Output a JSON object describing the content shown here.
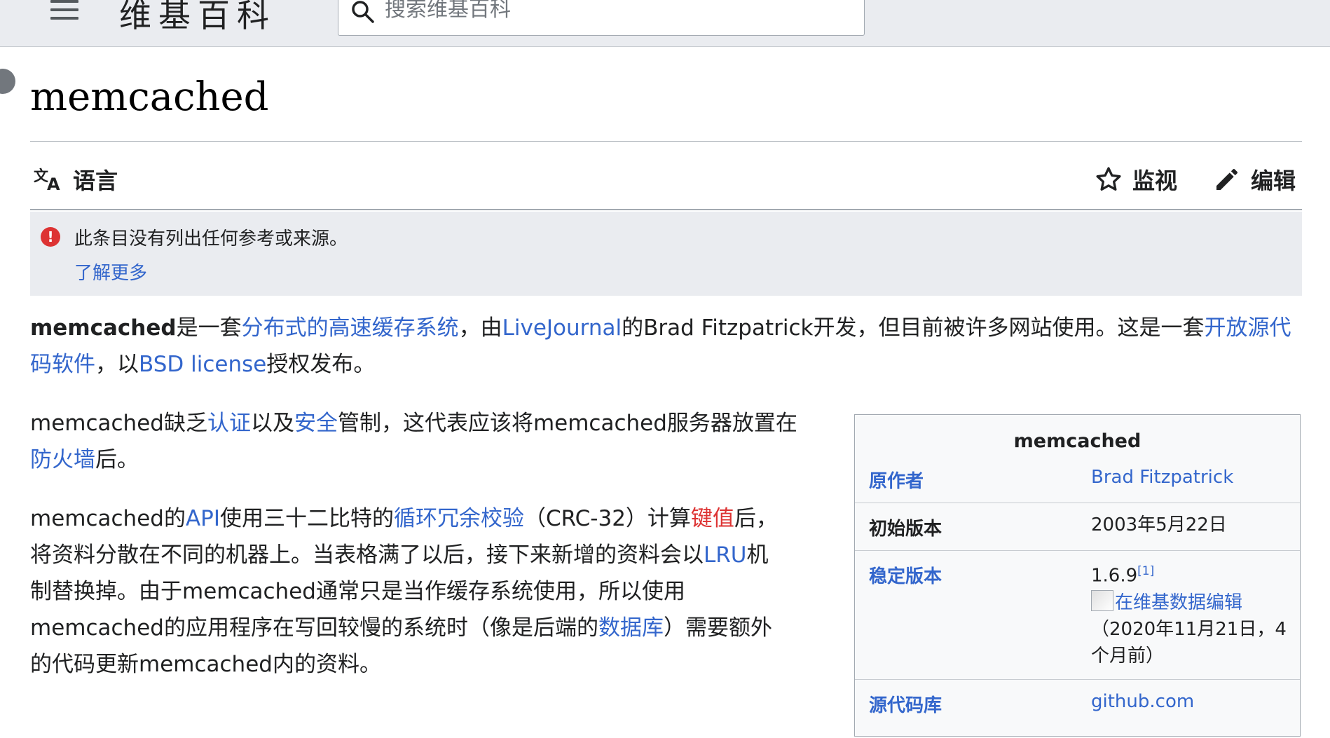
{
  "header": {
    "wordmark": "维基百科",
    "search_placeholder": "搜索维基百科"
  },
  "page": {
    "title": "memcached"
  },
  "toolbar": {
    "language_label": "语言",
    "watch_label": "监视",
    "edit_label": "编辑"
  },
  "notice": {
    "text": "此条目没有列出任何参考或来源。",
    "link": "了解更多"
  },
  "paragraph1": {
    "p1": "memcached",
    "p2": "是一套",
    "l1": "分布式的高速缓存系统",
    "p3": "，由",
    "l2": "LiveJournal",
    "p4": "的Brad Fitzpatrick开发，但目前被许多网站使用。这是一套",
    "l3a": "开放源代",
    "l3b": "码软件",
    "p5": "，以",
    "l4": "BSD license",
    "p6": "授权发布。"
  },
  "paragraph2": {
    "p1": "memcached缺乏",
    "l1": "认证",
    "p2": "以及",
    "l2": "安全",
    "p3": "管制，这代表应该将memcached服务器放置在",
    "l3": "防火墙",
    "p4": "后。"
  },
  "paragraph3": {
    "p1": "memcached的",
    "l1": "API",
    "p2": "使用三十二比特的",
    "l2": "循环冗余校验",
    "p3": "（CRC-32）计算",
    "l3": "键值",
    "p4": "后，",
    "p5": "将资料分散在不同的机器上。当表格满了以后，接下来新增的资料会以",
    "l4": "LRU",
    "p6": "机",
    "p7": "制替换掉。由于memcached通常只是当作缓存系统使用，所以使用",
    "p8": "memcached的应用程序在写回较慢的系统时（像是后端的",
    "l5": "数据库",
    "p9": "）需要额外",
    "p10": "的代码更新memcached内的资料。"
  },
  "infobox": {
    "title": "memcached",
    "author_label": "原作者",
    "author_value": "Brad Fitzpatrick",
    "initial_label": "初始版本",
    "initial_value": "2003年5月22日",
    "stable_label": "稳定版本",
    "stable_value": "1.6.9",
    "stable_ref": "[1]",
    "wikidata_link": "在维基数据编辑",
    "stable_date_1": "（2020年11月21日，4",
    "stable_date_2": "个月前）",
    "repo_label": "源代码库",
    "repo_value": "github.com"
  }
}
